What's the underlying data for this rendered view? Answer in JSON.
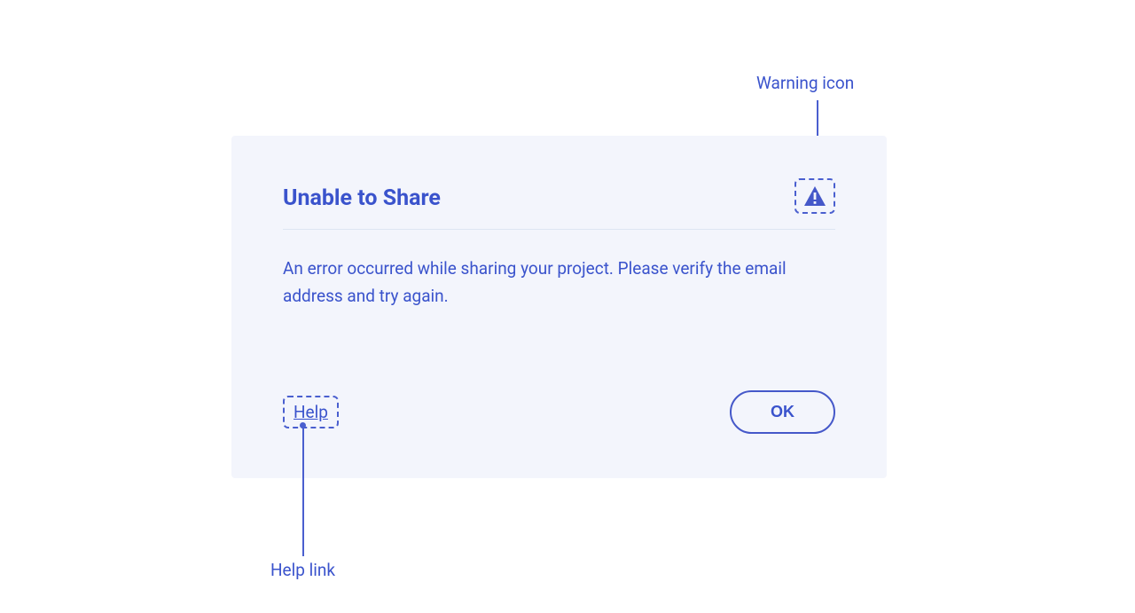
{
  "dialog": {
    "title": "Unable to Share",
    "body": "An error occurred while sharing your project. Please verify the email address and try again.",
    "help_label": "Help",
    "ok_label": "OK"
  },
  "annotations": {
    "warning_icon_label": "Warning icon",
    "help_link_label": "Help link"
  }
}
